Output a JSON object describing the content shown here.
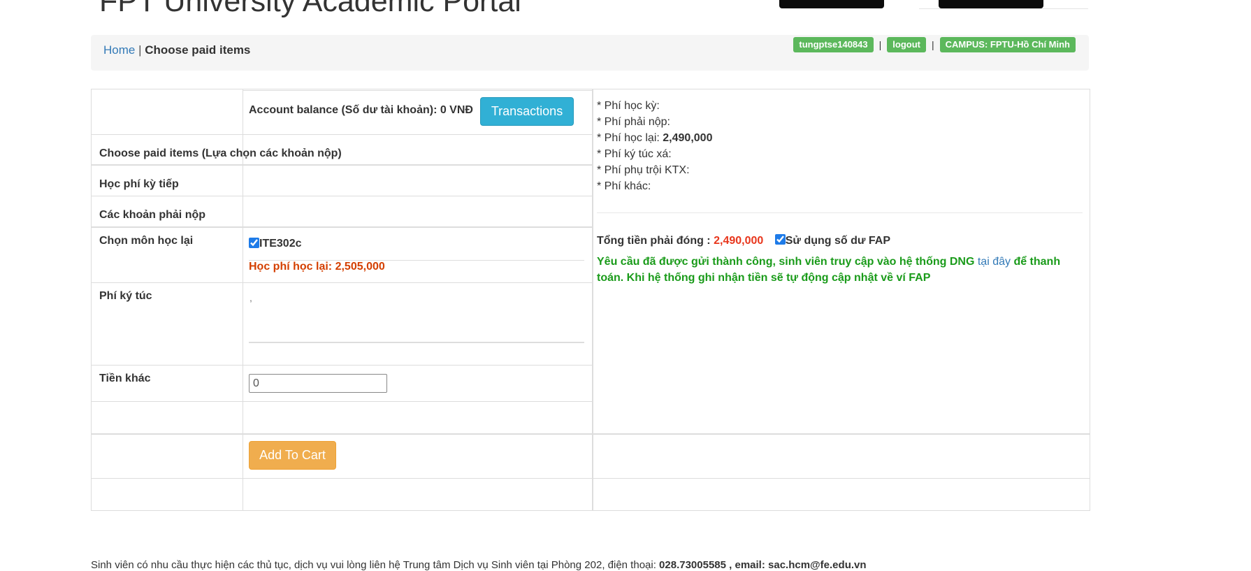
{
  "header": {
    "title": "FPT University Academic Portal"
  },
  "breadcrumb": {
    "home": "Home",
    "separator": "|",
    "current": "Choose paid items"
  },
  "user_badges": {
    "username": "tungptse140843",
    "logout": "logout",
    "campus": "CAMPUS: FPTU-Hồ Chí Minh",
    "separator": "|"
  },
  "form": {
    "account_balance": "Account balance (Số dư tài khoản): 0 VNĐ",
    "transactions_button": "Transactions",
    "choose_items_label": "Choose paid items (Lựa chọn các khoản nộp)",
    "next_term_fee_label": "Học phí kỳ tiếp",
    "payables_label": "Các khoản phải nộp",
    "retake_label": "Chọn môn học lại",
    "retake_course": "ITE302c",
    "retake_course_checked": true,
    "retake_fee_label": "Học phí học lại:",
    "retake_fee_value": "2,505,000",
    "dorm_fee_label": "Phí ký túc",
    "dorm_fee_value": ",",
    "other_label": "Tiền khác",
    "other_value": "0",
    "add_to_cart_button": "Add To Cart"
  },
  "summary": {
    "semester_fee_label": "* Phí học kỳ:",
    "payable_fee_label": "* Phí phải nộp:",
    "retake_fee_label": "* Phí học lại:",
    "retake_fee_value": "2,490,000",
    "dorm_fee_label": "* Phí ký túc xá:",
    "dorm_surcharge_label": "* Phí phụ trội KTX:",
    "other_fee_label": "* Phí khác:",
    "total_label": "Tổng tiền phải đóng :",
    "total_value": "2,490,000",
    "use_balance_label": "Sử dụng số dư FAP",
    "use_balance_checked": true,
    "message_part1": "Yêu cầu đã được gửi thành công, sinh viên truy cập vào hệ thống DNG",
    "message_link": "tại đây",
    "message_part2": "để thanh toán. Khi hệ thống ghi nhận tiền sẽ tự động cập nhật về ví FAP"
  },
  "footer": {
    "text": "Sinh viên có nhu cầu thực hiện các thủ tục, dịch vụ vui lòng liên hệ Trung tâm Dịch vụ Sinh viên tại Phòng 202, điện thoại:",
    "phone": "028.73005585",
    "email_label": ", email:",
    "email": "sac.hcm@fe.edu.vn"
  },
  "colors": {
    "badge": "#5cb85c",
    "info_button": "#31b0d5",
    "warning_button": "#f0ad4e",
    "link": "#337ab7",
    "success_text": "#1a9b1a",
    "amount_red": "#e8361c"
  }
}
